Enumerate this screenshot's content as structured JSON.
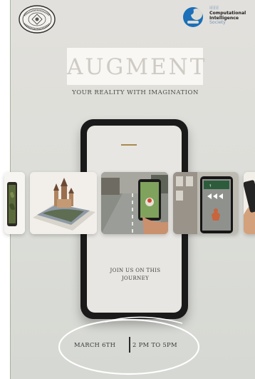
{
  "poster": {
    "title": "AUGMENT",
    "subtitle": "YOUR REALITY WITH IMAGINATION",
    "join_line1": "JOIN US ON THIS",
    "join_line2": "JOURNEY",
    "date": "MARCH 6TH",
    "time": "2 PM TO 5PM"
  },
  "logos": {
    "ieee_line1": "IEEE",
    "ieee_line2": "Computational",
    "ieee_line3": "Intelligence",
    "ieee_line4": "Society"
  },
  "icons": [
    "college-seal-icon",
    "ieee-cis-logo-icon"
  ],
  "colors": {
    "background": "#dcdcd7",
    "title": "#cfcbc4",
    "accent_dash": "#a88a4f",
    "ieee_blue": "#1c6fb8"
  }
}
